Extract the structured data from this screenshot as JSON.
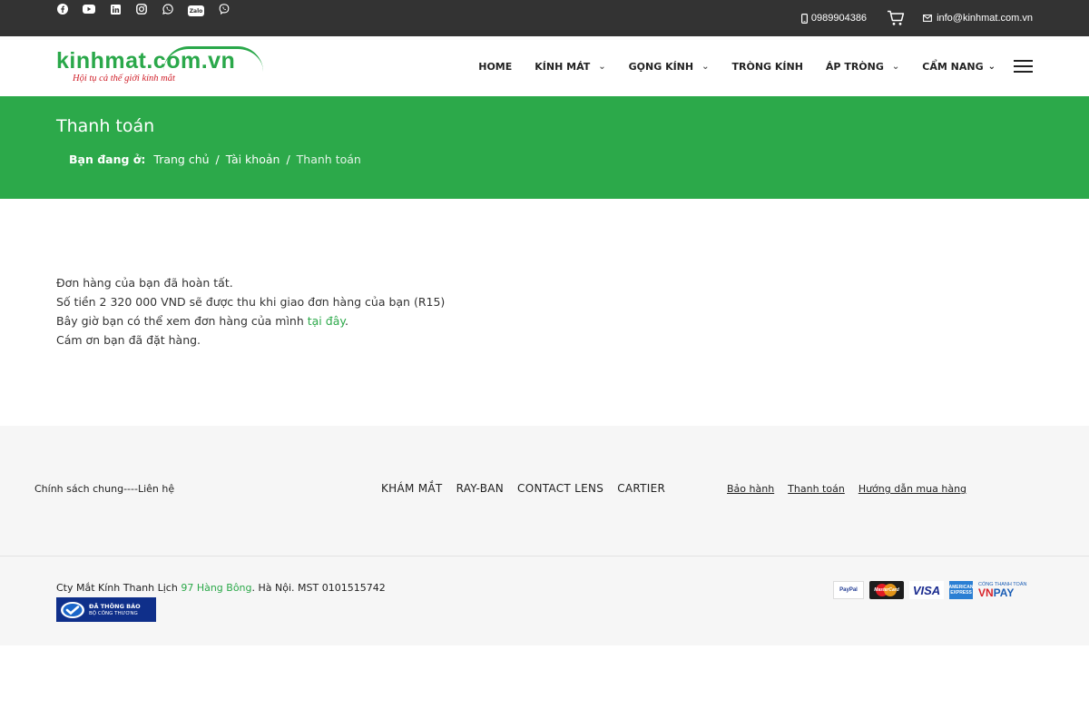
{
  "topbar": {
    "social_icons": [
      "facebook-icon",
      "youtube-icon",
      "linkedin-icon",
      "instagram-icon",
      "whatsapp-icon",
      "zalo-icon",
      "viber-icon"
    ],
    "zalo_label": "Zalo",
    "phone": "0989904386",
    "email": "info@kinhmat.com.vn"
  },
  "header": {
    "logo_text": "kinhmat.com.vn",
    "logo_tagline": "Hội tụ cả thế giới kính mắt",
    "nav": [
      {
        "label": "HOME",
        "has_dropdown": false
      },
      {
        "label": "KÍNH MÁT",
        "has_dropdown": true
      },
      {
        "label": "GỌNG KÍNH",
        "has_dropdown": true
      },
      {
        "label": "TRÒNG KÍNH",
        "has_dropdown": false
      },
      {
        "label": "ÁP TRÒNG",
        "has_dropdown": true
      },
      {
        "label": "CẨM NANG",
        "has_dropdown": true
      }
    ]
  },
  "banner": {
    "title": "Thanh toán",
    "breadcrumb_label": "Bạn đang ở:",
    "breadcrumb": [
      "Trang chủ",
      "Tài khoản",
      "Thanh toán"
    ],
    "separator": "/"
  },
  "main": {
    "line1": "Đơn hàng của bạn đã hoàn tất.",
    "line2": "Số tiền 2 320 000 VND sẽ được thu khi giao đơn hàng của bạn (R15)",
    "line3_prefix": "Bây giờ bạn có thể xem đơn hàng của mình ",
    "line3_link": "tại đây",
    "line3_suffix": ".",
    "line4": "Cám ơn bạn đã đặt hàng."
  },
  "footer": {
    "left_text": "Chính sách chung----Liên hệ",
    "middle_links": [
      "KHÁM MẮT",
      "RAY-BAN",
      "CONTACT LENS",
      "CARTIER"
    ],
    "right_links": [
      "Bảo hành",
      "Thanh toán",
      "Hướng dẫn mua hàng"
    ],
    "company_prefix": "Cty Mắt Kính Thanh Lịch ",
    "company_address": "97 Hàng Bông",
    "company_suffix": ". Hà Nội. MST 0101515742",
    "badge_line1": "ĐÃ THÔNG BÁO",
    "badge_line2": "BỘ CÔNG THƯƠNG",
    "payments": {
      "paypal": "PayPal",
      "mastercard": "MasterCard",
      "visa": "VISA",
      "amex": "AMERICAN EXPRESS",
      "vnpay_small": "CỔNG THANH TOÁN",
      "vnpay_vn": "VN",
      "vnpay_pay": "PAY"
    }
  }
}
